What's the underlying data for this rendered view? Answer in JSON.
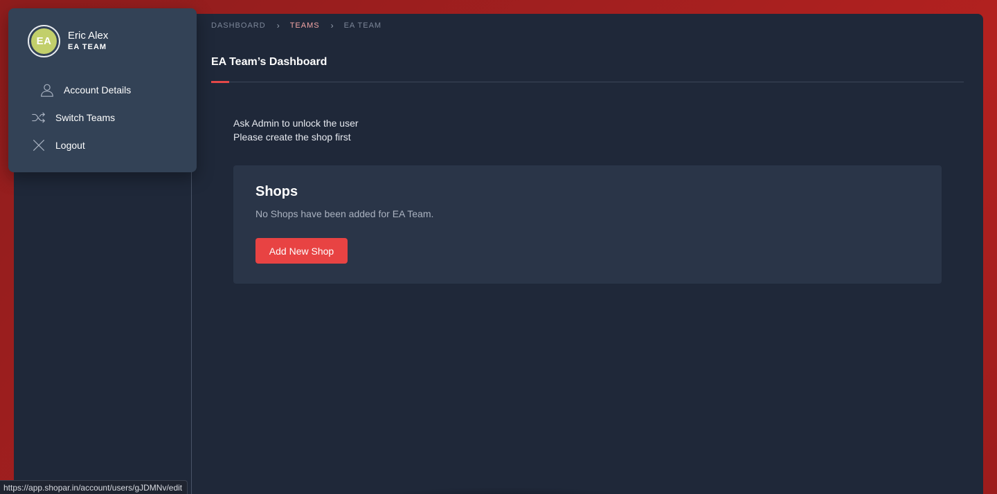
{
  "breadcrumb": {
    "items": [
      {
        "label": "DASHBOARD"
      },
      {
        "label": "TEAMS"
      },
      {
        "label": "EA TEAM"
      }
    ],
    "separator": "›"
  },
  "page": {
    "title": "EA Team’s Dashboard"
  },
  "notices": [
    "Ask Admin to unlock the user",
    "Please create the shop first"
  ],
  "shops": {
    "title": "Shops",
    "empty_message": "No Shops have been added for EA Team.",
    "add_button_label": "Add New Shop"
  },
  "user_menu": {
    "avatar_initials": "EA",
    "name": "Eric Alex",
    "team": "EA TEAM",
    "items": [
      {
        "label": "Account Details",
        "icon": "user-icon"
      },
      {
        "label": "Switch Teams",
        "icon": "shuffle-icon"
      },
      {
        "label": "Logout",
        "icon": "close-icon"
      }
    ]
  },
  "status_bar": {
    "url": "https://app.shopar.in/account/users/gJDMNv/edit"
  },
  "colors": {
    "accent": "#e84343",
    "avatar": "#c2cf6b",
    "panel": "#1f2839",
    "card": "#2a3548",
    "menu": "#334256"
  }
}
